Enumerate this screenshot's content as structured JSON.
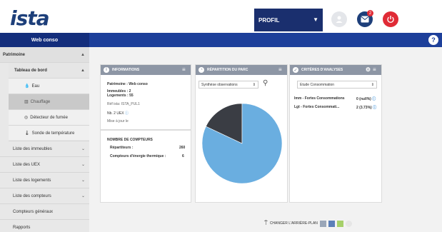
{
  "header": {
    "logo": "ista",
    "profile_label": "PROFIL",
    "mail_badge": "2"
  },
  "nav": {
    "app_name": "Web conso",
    "help": "?"
  },
  "sidebar": {
    "items": [
      {
        "label": "Patrimoine"
      },
      {
        "label": "Tableau de bord"
      },
      {
        "label": "Eau"
      },
      {
        "label": "Chauffage"
      },
      {
        "label": "Détecteur de fumée"
      },
      {
        "label": "Sonde de température"
      },
      {
        "label": "Liste des immeubles"
      },
      {
        "label": "Liste des UEX"
      },
      {
        "label": "Liste des logements"
      },
      {
        "label": "Liste des compteurs"
      },
      {
        "label": "Compteurs généraux"
      },
      {
        "label": "Rapports"
      }
    ]
  },
  "informations": {
    "title": "INFORMATIONS",
    "patrimoine": "Patrimoine : Web conso",
    "immeubles": "Immeubles : 2",
    "logements": "Logements : 55",
    "ref": "Réf ista: ISTA_PUL1",
    "uex": "Nb. 2 UEX",
    "maj": "Mise à jour le",
    "compteurs_title": "NOMBRE DE COMPTEURS",
    "repartiteurs_label": "Répartiteurs :",
    "repartiteurs_value": "260",
    "energie_label": "Compteurs d'énergie thermique :",
    "energie_value": "6"
  },
  "repartition": {
    "title": "RÉPARTITION DU PARC",
    "select_value": "Synthèse observations"
  },
  "criteres": {
    "title": "CRITÈRES D'ANALYSES",
    "select_value": "Etude Consommation",
    "rows": [
      {
        "label": "Imm - Fortes Consommations",
        "value": "0 (null%)"
      },
      {
        "label": "Lgt - Fortes Consommati...",
        "value": "2 (3.73%)"
      }
    ]
  },
  "footer": {
    "change_bg": "CHANGER L'ARRIÈRE-PLAN"
  },
  "chart_data": {
    "type": "pie",
    "slices": [
      {
        "value": 82,
        "color": "#6aaee0"
      },
      {
        "value": 18,
        "color": "#3a3d44"
      }
    ]
  }
}
